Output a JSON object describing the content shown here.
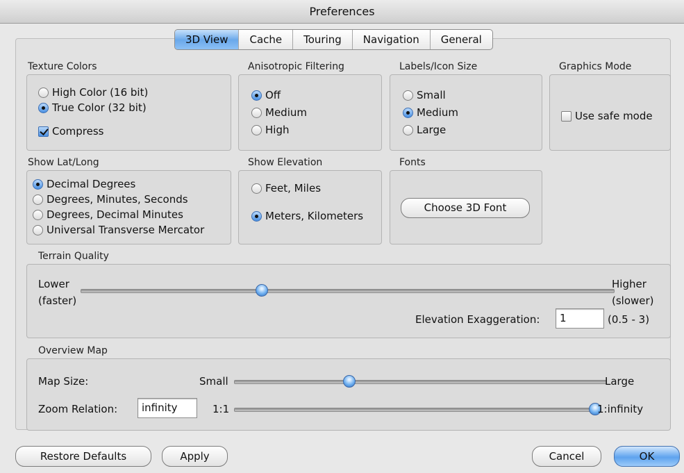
{
  "window": {
    "title": "Preferences"
  },
  "tabs": [
    "3D View",
    "Cache",
    "Touring",
    "Navigation",
    "General"
  ],
  "texture": {
    "label": "Texture Colors",
    "options": [
      "High Color (16 bit)",
      "True Color (32 bit)"
    ],
    "selected": 1,
    "compress_label": "Compress",
    "compress_checked": true
  },
  "aniso": {
    "label": "Anisotropic Filtering",
    "options": [
      "Off",
      "Medium",
      "High"
    ],
    "selected": 0
  },
  "labels_icon": {
    "label": "Labels/Icon Size",
    "options": [
      "Small",
      "Medium",
      "Large"
    ],
    "selected": 1
  },
  "graphics": {
    "label": "Graphics Mode",
    "safe_mode_label": "Use safe mode",
    "safe_mode_checked": false
  },
  "latlong": {
    "label": "Show Lat/Long",
    "options": [
      "Decimal Degrees",
      "Degrees, Minutes, Seconds",
      "Degrees, Decimal Minutes",
      "Universal Transverse Mercator"
    ],
    "selected": 0
  },
  "elevation": {
    "label": "Show Elevation",
    "options": [
      "Feet, Miles",
      "Meters, Kilometers"
    ],
    "selected": 1
  },
  "fonts": {
    "label": "Fonts",
    "button": "Choose 3D Font"
  },
  "terrain": {
    "label": "Terrain Quality",
    "lower": "Lower",
    "lower_sub": "(faster)",
    "higher": "Higher",
    "higher_sub": "(slower)",
    "slider_value": 0.34,
    "exag_label": "Elevation Exaggeration:",
    "exag_value": "1",
    "exag_range": "(0.5 - 3)"
  },
  "overview": {
    "label": "Overview Map",
    "map_size_label": "Map Size:",
    "small": "Small",
    "large": "Large",
    "map_size_value": 0.31,
    "zoom_label": "Zoom Relation:",
    "zoom_value": "infinity",
    "zoom_min": "1:1",
    "zoom_max": "1:infinity",
    "zoom_slider_value": 1.0
  },
  "buttons": {
    "restore": "Restore Defaults",
    "apply": "Apply",
    "cancel": "Cancel",
    "ok": "OK"
  }
}
